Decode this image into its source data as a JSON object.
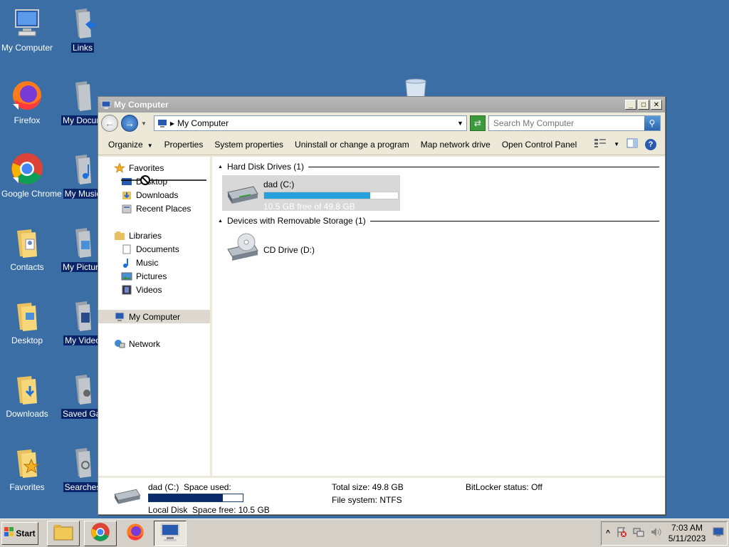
{
  "desktop": {
    "icons": [
      {
        "label": "My Computer"
      },
      {
        "label": "Links"
      },
      {
        "label": "Firefox"
      },
      {
        "label": "My Docume"
      },
      {
        "label": "Google Chrome"
      },
      {
        "label": "My Music"
      },
      {
        "label": "Contacts"
      },
      {
        "label": "My Picture"
      },
      {
        "label": "Desktop"
      },
      {
        "label": "My Video"
      },
      {
        "label": "Downloads"
      },
      {
        "label": "Saved Gam"
      },
      {
        "label": "Favorites"
      },
      {
        "label": "Searches"
      }
    ]
  },
  "window": {
    "title": "My Computer",
    "address": "My Computer",
    "search_placeholder": "Search My Computer",
    "commands": [
      "Organize",
      "Properties",
      "System properties",
      "Uninstall or change a program",
      "Map network drive",
      "Open Control Panel"
    ],
    "nav": {
      "favorites": "Favorites",
      "desktop": "Desktop",
      "downloads": "Downloads",
      "recent": "Recent Places",
      "libraries": "Libraries",
      "documents": "Documents",
      "music": "Music",
      "pictures": "Pictures",
      "videos": "Videos",
      "mycomputer": "My Computer",
      "network": "Network"
    },
    "groups": {
      "hdd_header": "Hard Disk Drives (1)",
      "removable_header": "Devices with Removable Storage (1)"
    },
    "drive_c": {
      "name": "dad (C:)",
      "free_text": "10.5 GB free of 49.8 GB",
      "used_fraction": 0.79
    },
    "drive_d": {
      "name": "CD Drive (D:)"
    },
    "details": {
      "name": "dad (C:)",
      "type": "Local Disk",
      "space_used_label": "Space used:",
      "space_free_label": "Space free:",
      "space_free": "10.5 GB",
      "total_size_label": "Total size:",
      "total_size": "49.8 GB",
      "filesystem_label": "File system:",
      "filesystem": "NTFS",
      "bitlocker_label": "BitLocker status:",
      "bitlocker": "Off",
      "used_fraction": 0.79
    }
  },
  "taskbar": {
    "start": "Start",
    "time": "7:03 AM",
    "date": "5/11/2023"
  },
  "colors": {
    "desktop": "#3a6ea5",
    "selection": "#0a246a",
    "bar_fill": "#26a0da",
    "used_fill": "#0a2a6a"
  }
}
